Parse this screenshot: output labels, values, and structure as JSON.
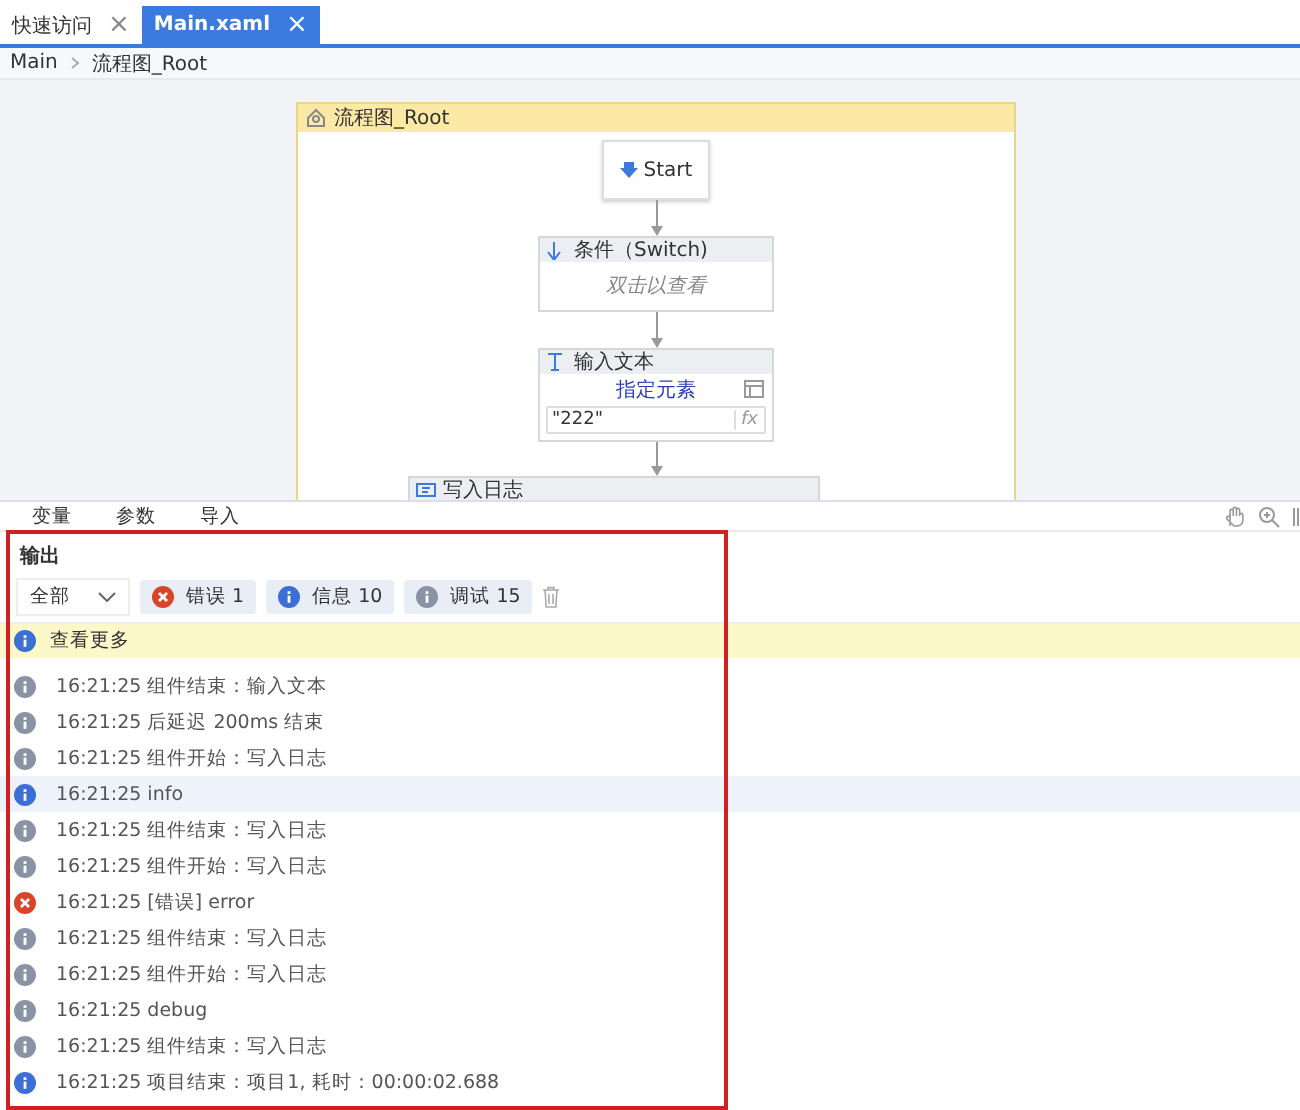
{
  "tabs": [
    {
      "label": "快速访问",
      "close": "×",
      "selected": false
    },
    {
      "label": "Main.xaml",
      "close": "×",
      "selected": true
    }
  ],
  "breadcrumb": [
    "Main",
    "流程图_Root"
  ],
  "flowchart": {
    "title": "流程图_Root",
    "nodes": [
      {
        "kind": "start",
        "title": "Start"
      },
      {
        "kind": "switch",
        "title": "条件（Switch)",
        "hint": "双击以查看"
      },
      {
        "kind": "input",
        "title": "输入文本",
        "link": "指定元素",
        "value": "\"222\"",
        "fx": "fx"
      },
      {
        "kind": "log",
        "title": "写入日志"
      }
    ]
  },
  "bottom_tabs": [
    "变量",
    "参数",
    "导入"
  ],
  "output": {
    "title": "输出",
    "filter": "全部",
    "chips": [
      {
        "kind": "error",
        "label": "错误 1"
      },
      {
        "kind": "info",
        "label": "信息 10"
      },
      {
        "kind": "debug",
        "label": "调试 15"
      }
    ],
    "more": "查看更多",
    "logs": [
      {
        "kind": "debug",
        "text": "16:21:25 组件结束：输入文本",
        "selected": false
      },
      {
        "kind": "debug",
        "text": "16:21:25 后延迟 200ms 结束",
        "selected": false
      },
      {
        "kind": "debug",
        "text": "16:21:25 组件开始：写入日志",
        "selected": false
      },
      {
        "kind": "info",
        "text": "16:21:25 info",
        "selected": true
      },
      {
        "kind": "debug",
        "text": "16:21:25 组件结束：写入日志",
        "selected": false
      },
      {
        "kind": "debug",
        "text": "16:21:25 组件开始：写入日志",
        "selected": false
      },
      {
        "kind": "error",
        "text": "16:21:25 [错误] error",
        "selected": false
      },
      {
        "kind": "debug",
        "text": "16:21:25 组件结束：写入日志",
        "selected": false
      },
      {
        "kind": "debug",
        "text": "16:21:25 组件开始：写入日志",
        "selected": false
      },
      {
        "kind": "debug",
        "text": "16:21:25 debug",
        "selected": false
      },
      {
        "kind": "debug",
        "text": "16:21:25 组件结束：写入日志",
        "selected": false
      },
      {
        "kind": "info",
        "text": "16:21:25 项目结束：项目1, 耗时：00:00:02.688",
        "selected": false
      }
    ]
  }
}
